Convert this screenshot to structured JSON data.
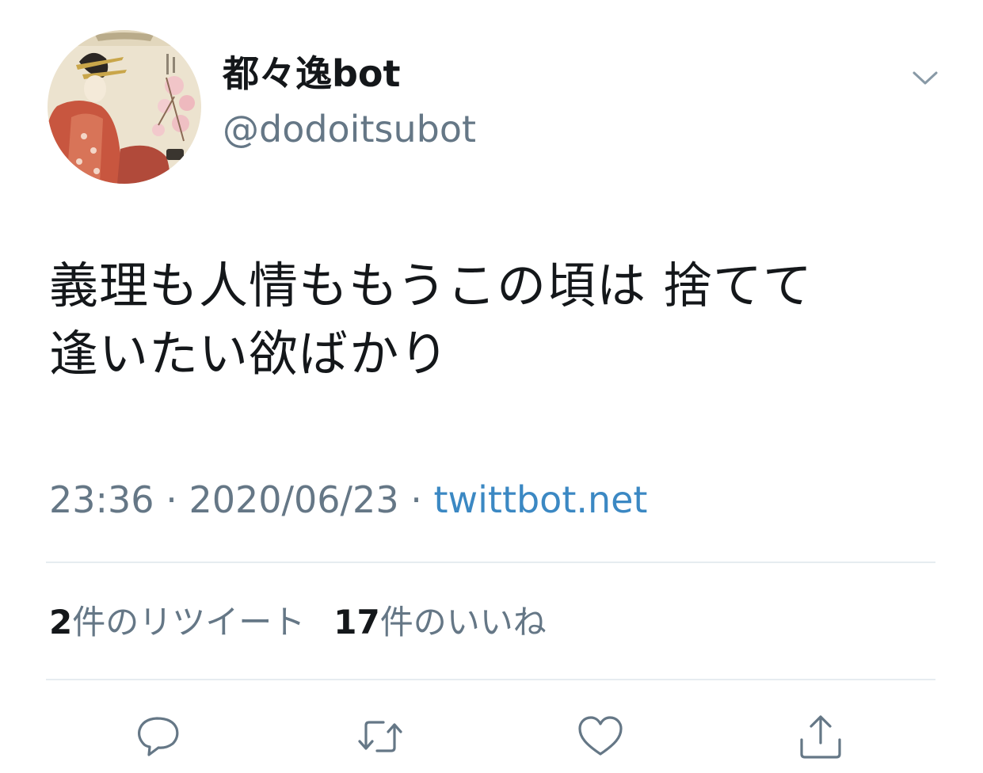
{
  "tweet": {
    "display_name": "都々逸bot",
    "handle": "@dodoitsubot",
    "text_lines": [
      "義理も人情ももうこの頃は 捨てて",
      "逢いたい欲ばかり"
    ],
    "time": "23:36",
    "separator": " · ",
    "date": "2020/06/23",
    "source": "twittbot.net"
  },
  "stats": {
    "retweets_count": "2",
    "retweets_label": "件のリツイート",
    "likes_count": "17",
    "likes_label": "件のいいね"
  },
  "icons": {
    "avatar": "ukiyoe-courtesan-avatar",
    "caret": "chevron-down-icon",
    "reply": "reply-icon",
    "retweet": "retweet-icon",
    "like": "heart-icon",
    "share": "share-icon"
  },
  "colors": {
    "text_primary": "#14171a",
    "text_secondary": "#657786",
    "link": "#3b88c3",
    "icon": "#657786",
    "divider": "#e6ecf0"
  }
}
